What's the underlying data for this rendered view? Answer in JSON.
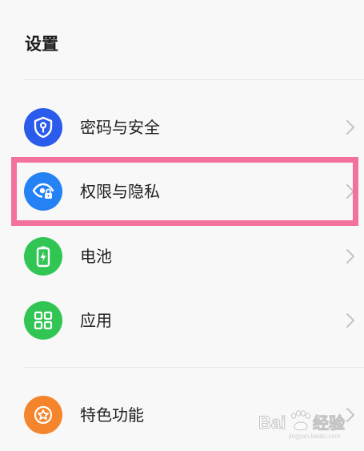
{
  "header": {
    "title": "设置"
  },
  "settings": {
    "items": [
      {
        "label": "密码与安全",
        "icon": "shield-lock-icon",
        "color": "#2a5bea"
      },
      {
        "label": "权限与隐私",
        "icon": "eye-privacy-icon",
        "color": "#2582f5"
      },
      {
        "label": "电池",
        "icon": "battery-icon",
        "color": "#31c653"
      },
      {
        "label": "应用",
        "icon": "app-grid-icon",
        "color": "#31c653"
      },
      {
        "label": "特色功能",
        "icon": "star-icon",
        "color": "#f5852c"
      }
    ]
  },
  "highlight": {
    "color": "#f2729d"
  },
  "watermark": {
    "brand": "Baidu 经验"
  }
}
